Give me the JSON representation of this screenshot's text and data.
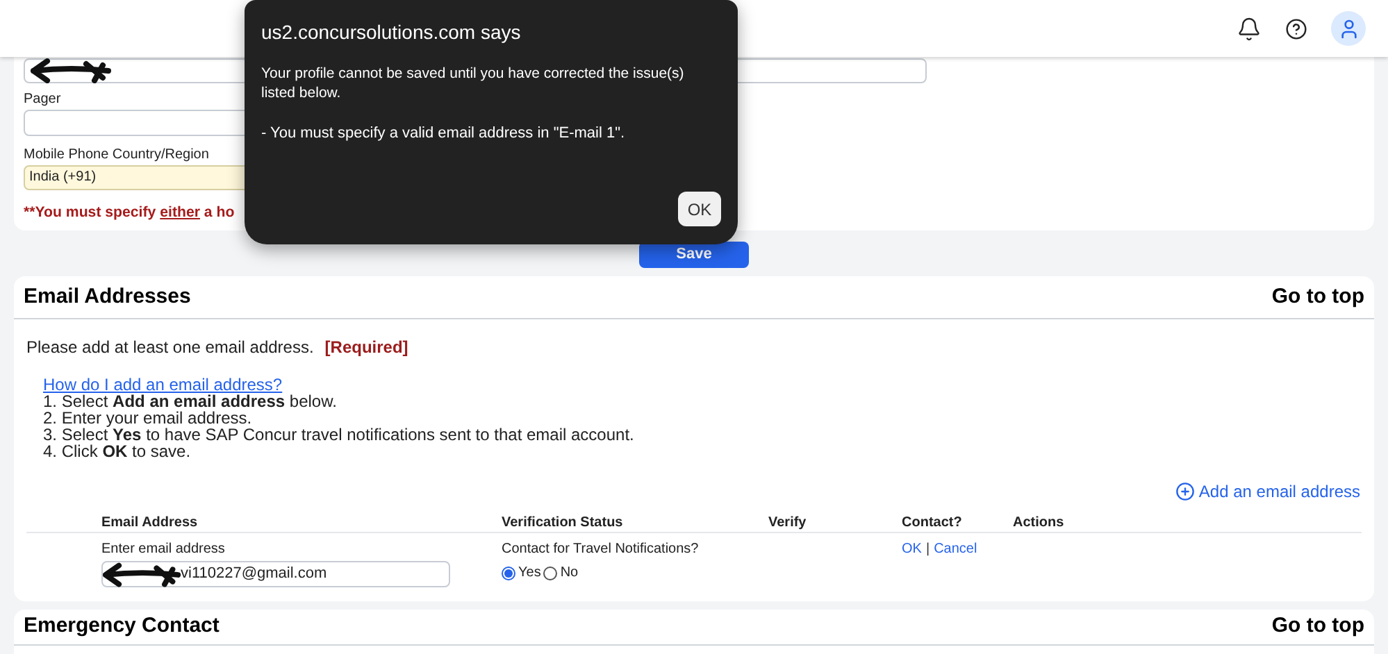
{
  "phone_section": {
    "pager_label": "Pager",
    "mobile_country_label": "Mobile Phone Country/Region",
    "mobile_country_value": "India (+91)",
    "error": "**You must specify *either* a ho"
  },
  "save_button": "Save",
  "email_section": {
    "title": "Email Addresses",
    "go_to_top": "Go to top",
    "intro": "Please add at least one email address.",
    "required": "[Required]",
    "help_link": "How do I add an email address?",
    "steps": [
      "1. Select **Add an email address** below.",
      "2. Enter your email address.",
      "3. Select **Yes** to have SAP Concur travel notifications sent to that email account.",
      "4. Click **OK** to save."
    ],
    "add_link": "Add an email address",
    "columns": [
      "Email Address",
      "Verification Status",
      "Verify",
      "Contact?",
      "Actions"
    ],
    "row": {
      "field_label": "Enter email address",
      "value": "vi110227@gmail.com",
      "contact_label": "Contact for Travel Notifications?",
      "options": [
        {
          "label": "Yes",
          "selected": true
        },
        {
          "label": "No",
          "selected": false
        }
      ],
      "ok": "OK",
      "separator": "|",
      "cancel": "Cancel"
    }
  },
  "emergency_section": {
    "title": "Emergency Contact",
    "go_to_top": "Go to top"
  },
  "dialog": {
    "title": "us2.concursolutions.com says",
    "message": "Your profile cannot be saved until you have corrected the issue(s) listed below.",
    "detail": "- You must specify a valid email address in \"E-mail 1\".",
    "ok": "OK"
  }
}
